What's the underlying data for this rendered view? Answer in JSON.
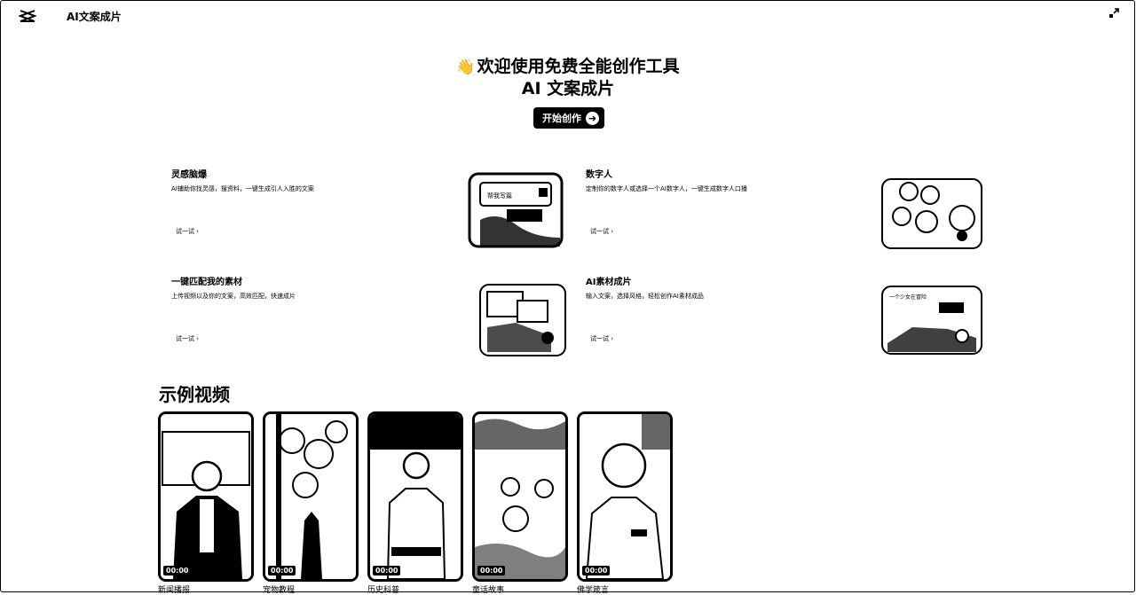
{
  "app": {
    "title": "AI文案成片"
  },
  "hero": {
    "line1": "欢迎使用免费全能创作工具",
    "line2": "AI 文案成片",
    "cta_label": "开始创作",
    "wave_icon": "👋"
  },
  "features": [
    {
      "title": "灵感脑爆",
      "desc": "AI辅助你找灵感，搜资料，一键生成引人入胜的文案",
      "try_label": "试一试 ›",
      "img_text": "帮我写篇"
    },
    {
      "title": "数字人",
      "desc": "定制你的数字人或选择一个AI数字人，一键生成数字人口播",
      "try_label": "试一试 ›"
    },
    {
      "title": "一键匹配我的素材",
      "desc": "上传视频以及你的文案，高效匹配，快速成片",
      "try_label": "试一试 ›"
    },
    {
      "title": "AI素材成片",
      "desc": "输入文案，选择风格，轻松创作AI素材成品",
      "try_label": "试一试 ›",
      "img_text": "一个少女在冒险"
    }
  ],
  "examples": {
    "title": "示例视频",
    "videos": [
      {
        "label": "新闻播报",
        "duration": "00:00"
      },
      {
        "label": "宠物教程",
        "duration": "00:00"
      },
      {
        "label": "历史科普",
        "duration": "00:00"
      },
      {
        "label": "童话故事",
        "duration": "00:00"
      },
      {
        "label": "佛学箴言",
        "duration": "00:00"
      }
    ]
  }
}
